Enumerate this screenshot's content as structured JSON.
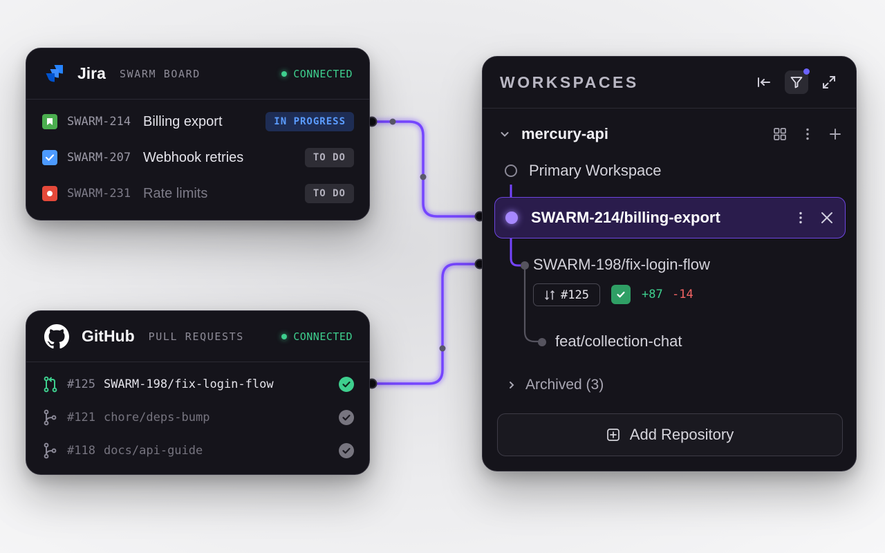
{
  "jira": {
    "brand": "Jira",
    "subtitle": "SWARM BOARD",
    "status": "CONNECTED",
    "issues": [
      {
        "key": "SWARM-214",
        "title": "Billing export",
        "status": "IN PROGRESS",
        "type_icon": "story-icon",
        "color": "#4bae4f"
      },
      {
        "key": "SWARM-207",
        "title": "Webhook retries",
        "status": "TO DO",
        "type_icon": "task-icon",
        "color": "#4c9aff"
      },
      {
        "key": "SWARM-231",
        "title": "Rate limits",
        "status": "TO DO",
        "type_icon": "bug-icon",
        "color": "#e5493a"
      }
    ]
  },
  "github": {
    "brand": "GitHub",
    "subtitle": "PULL REQUESTS",
    "status": "CONNECTED",
    "prs": [
      {
        "number": "#125",
        "branch": "SWARM-198/fix-login-flow",
        "state": "open"
      },
      {
        "number": "#121",
        "branch": "chore/deps-bump",
        "state": "merged"
      },
      {
        "number": "#118",
        "branch": "docs/api-guide",
        "state": "merged"
      }
    ]
  },
  "workspaces": {
    "title": "WORKSPACES",
    "repo": "mercury-api",
    "primary": "Primary Workspace",
    "selected": "SWARM-214/billing-export",
    "child": "SWARM-198/fix-login-flow",
    "child_pr": "#125",
    "additions": "+87",
    "deletions": "-14",
    "grandchild": "feat/collection-chat",
    "archived": "Archived (3)",
    "add_repository": "Add Repository"
  },
  "colors": {
    "accent": "#7b4dff",
    "connected": "#3ecf8e",
    "in_progress": "#5b9cff",
    "additions": "#3ecf8e",
    "deletions": "#f26363"
  }
}
